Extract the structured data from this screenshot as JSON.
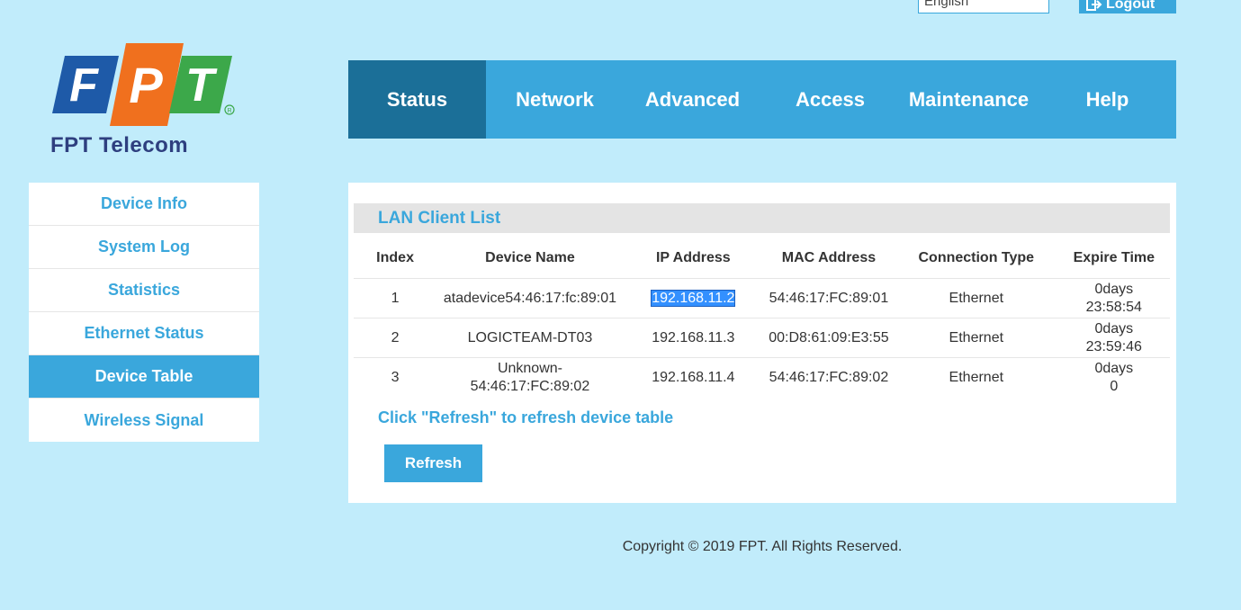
{
  "header": {
    "language": "English",
    "logout_label": "Logout"
  },
  "brand": {
    "company": "FPT Telecom",
    "logo_letters": "FPT",
    "colors": {
      "blue": "#1e5aa8",
      "orange": "#f0701e",
      "green": "#3ca84a"
    }
  },
  "nav": {
    "items": [
      {
        "label": "Status",
        "active": true
      },
      {
        "label": "Network",
        "active": false
      },
      {
        "label": "Advanced",
        "active": false
      },
      {
        "label": "Access",
        "active": false
      },
      {
        "label": "Maintenance",
        "active": false
      },
      {
        "label": "Help",
        "active": false
      }
    ]
  },
  "sidebar": {
    "items": [
      {
        "label": "Device Info",
        "active": false
      },
      {
        "label": "System Log",
        "active": false
      },
      {
        "label": "Statistics",
        "active": false
      },
      {
        "label": "Ethernet Status",
        "active": false
      },
      {
        "label": "Device Table",
        "active": true
      },
      {
        "label": "Wireless Signal",
        "active": false
      }
    ]
  },
  "main": {
    "title": "LAN Client List",
    "columns": [
      "Index",
      "Device Name",
      "IP Address",
      "MAC Address",
      "Connection Type",
      "Expire Time"
    ],
    "rows": [
      {
        "index": "1",
        "name": "atadevice54:46:17:fc:89:01",
        "ip": "192.168.11.2",
        "mac": "54:46:17:FC:89:01",
        "conn": "Ethernet",
        "expire_days": "0days",
        "expire_time": "23:58:54"
      },
      {
        "index": "2",
        "name": "LOGICTEAM-DT03",
        "ip": "192.168.11.3",
        "mac": "00:D8:61:09:E3:55",
        "conn": "Ethernet",
        "expire_days": "0days",
        "expire_time": "23:59:46"
      },
      {
        "index": "3",
        "name": "Unknown-54:46:17:FC:89:02",
        "name_line1": "Unknown-",
        "name_line2": "54:46:17:FC:89:02",
        "ip": "192.168.11.4",
        "mac": "54:46:17:FC:89:02",
        "conn": "Ethernet",
        "expire_days": "0days",
        "expire_time": "0"
      }
    ],
    "refresh_hint": "Click \"Refresh\" to refresh device table",
    "refresh_label": "Refresh"
  },
  "footer": {
    "copyright": "Copyright © 2019 FPT. All Rights Reserved."
  },
  "colors": {
    "page_bg": "#c1ecfb",
    "accent": "#3aa7dc",
    "nav_active": "#1b6f98",
    "selection": "#3390ff"
  }
}
